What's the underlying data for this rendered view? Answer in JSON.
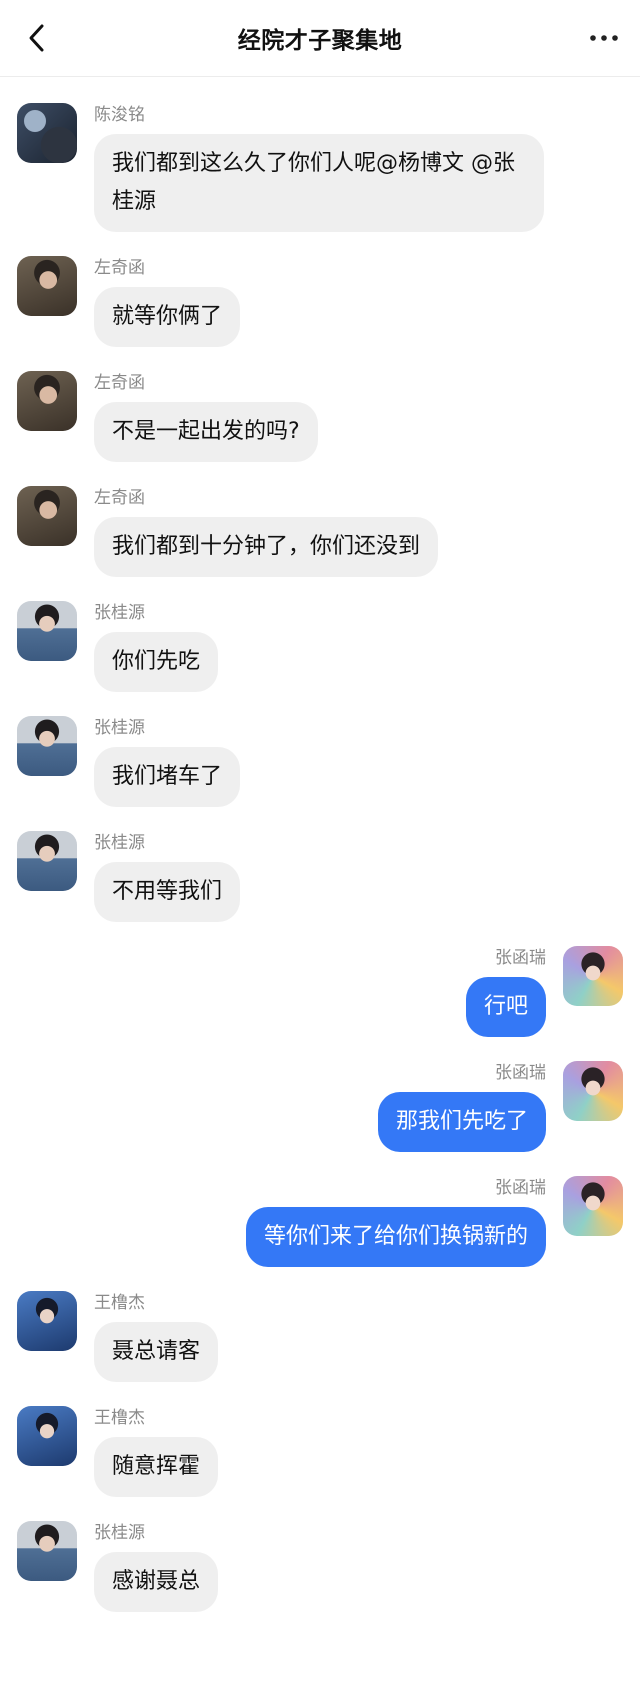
{
  "header": {
    "title": "经院才子聚集地",
    "back_icon": "chevron-left-icon",
    "more_icon": "more-horizontal-icon"
  },
  "colors": {
    "outgoing_bubble": "#3478f6",
    "incoming_bubble": "#efefef",
    "sender_name": "#8a8a8a"
  },
  "messages": [
    {
      "sender": "陈浚铭",
      "text": "我们都到这么久了你们人呢@杨博文 @张桂源",
      "direction": "incoming",
      "avatar": "chen"
    },
    {
      "sender": "左奇函",
      "text": "就等你俩了",
      "direction": "incoming",
      "avatar": "zuo"
    },
    {
      "sender": "左奇函",
      "text": "不是一起出发的吗?",
      "direction": "incoming",
      "avatar": "zuo"
    },
    {
      "sender": "左奇函",
      "text": "我们都到十分钟了，你们还没到",
      "direction": "incoming",
      "avatar": "zuo"
    },
    {
      "sender": "张桂源",
      "text": "你们先吃",
      "direction": "incoming",
      "avatar": "zhanggy"
    },
    {
      "sender": "张桂源",
      "text": "我们堵车了",
      "direction": "incoming",
      "avatar": "zhanggy"
    },
    {
      "sender": "张桂源",
      "text": "不用等我们",
      "direction": "incoming",
      "avatar": "zhanggy"
    },
    {
      "sender": "张函瑞",
      "text": "行吧",
      "direction": "outgoing",
      "avatar": "zhanghr"
    },
    {
      "sender": "张函瑞",
      "text": "那我们先吃了",
      "direction": "outgoing",
      "avatar": "zhanghr"
    },
    {
      "sender": "张函瑞",
      "text": "等你们来了给你们换锅新的",
      "direction": "outgoing",
      "avatar": "zhanghr"
    },
    {
      "sender": "王橹杰",
      "text": "聂总请客",
      "direction": "incoming",
      "avatar": "wang"
    },
    {
      "sender": "王橹杰",
      "text": "随意挥霍",
      "direction": "incoming",
      "avatar": "wang"
    },
    {
      "sender": "张桂源",
      "text": "感谢聂总",
      "direction": "incoming",
      "avatar": "zhanggy"
    }
  ]
}
